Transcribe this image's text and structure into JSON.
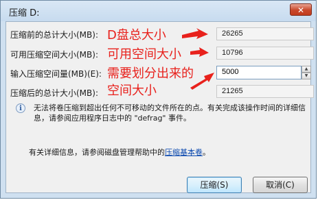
{
  "window": {
    "title": "压缩 D:",
    "close_label": "✕"
  },
  "fields": [
    {
      "label": "压缩前的总计大小(MB):",
      "value": "26265"
    },
    {
      "label": "可用压缩空间大小(MB):",
      "value": "10796"
    },
    {
      "label": "输入压缩空间量(MB)(E):",
      "value": "5000"
    },
    {
      "label": "压缩后的总计大小(MB):",
      "value": "21265"
    }
  ],
  "annotations": {
    "disk_total": "D盘总大小",
    "available": "可用空间大小",
    "input_line1": "需要划分出来的",
    "input_line2": "空间大小",
    "color": "#e8211c"
  },
  "info": {
    "icon": "info-icon",
    "text": "无法将卷压缩到超出任何不可移动的文件所在的点。有关完成该操作时间的详细信息，请参阅应用程序日志中的 \"defrag\" 事件。"
  },
  "details": {
    "prefix": "有关详细信息，请参阅磁盘管理帮助中的",
    "link": "压缩基本卷",
    "suffix": "。"
  },
  "buttons": {
    "shrink": "压缩(S)",
    "cancel": "取消(C)"
  }
}
